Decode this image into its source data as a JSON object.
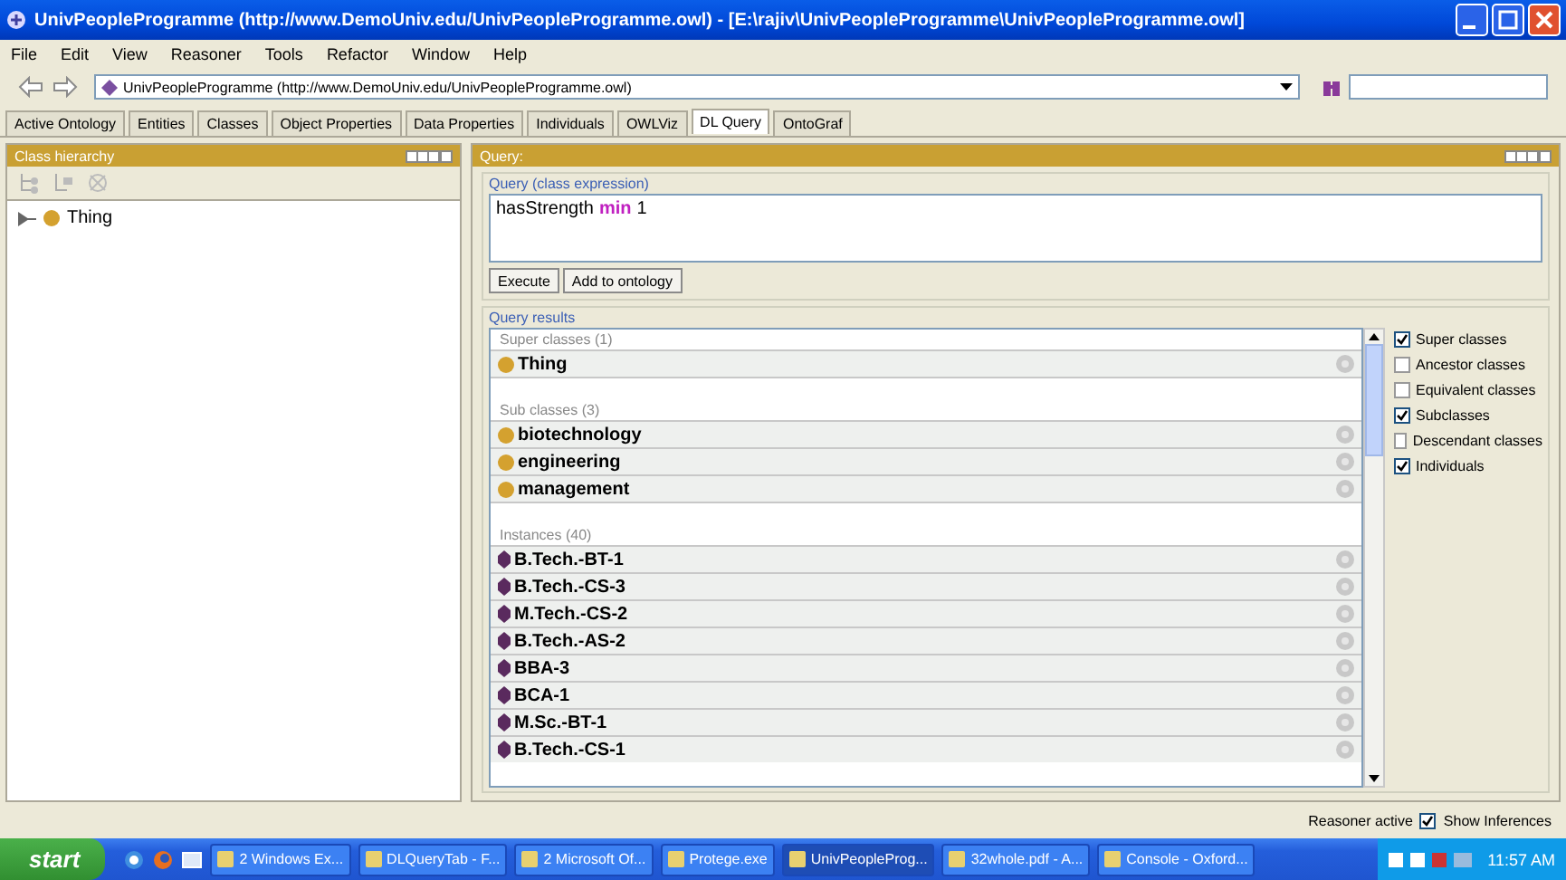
{
  "window": {
    "title": "UnivPeopleProgramme (http://www.DemoUniv.edu/UnivPeopleProgramme.owl) - [E:\\rajiv\\UnivPeopleProgramme\\UnivPeopleProgramme.owl]"
  },
  "menu": [
    "File",
    "Edit",
    "View",
    "Reasoner",
    "Tools",
    "Refactor",
    "Window",
    "Help"
  ],
  "address": {
    "value": "UnivPeopleProgramme (http://www.DemoUniv.edu/UnivPeopleProgramme.owl)"
  },
  "tabs": [
    {
      "label": "Active Ontology",
      "selected": false
    },
    {
      "label": "Entities",
      "selected": false
    },
    {
      "label": "Classes",
      "selected": false
    },
    {
      "label": "Object Properties",
      "selected": false
    },
    {
      "label": "Data Properties",
      "selected": false
    },
    {
      "label": "Individuals",
      "selected": false
    },
    {
      "label": "OWLViz",
      "selected": false
    },
    {
      "label": "DL Query",
      "selected": true
    },
    {
      "label": "OntoGraf",
      "selected": false
    }
  ],
  "class_hierarchy": {
    "title": "Class hierarchy",
    "tree": [
      {
        "label": "Thing",
        "expanded": false
      }
    ]
  },
  "query": {
    "title": "Query:",
    "expression_label": "Query (class expression)",
    "expression": [
      {
        "text": "hasStrength",
        "kind": "entity"
      },
      {
        "text": "min",
        "kind": "keyword"
      },
      {
        "text": "1",
        "kind": "literal"
      }
    ],
    "buttons": [
      "Execute",
      "Add to ontology"
    ]
  },
  "results": {
    "title": "Query results",
    "sections": [
      {
        "header": "Super classes (1)",
        "items": [
          {
            "label": "Thing",
            "kind": "class"
          }
        ]
      },
      {
        "header": "Sub classes (3)",
        "items": [
          {
            "label": "biotechnology",
            "kind": "class"
          },
          {
            "label": "engineering",
            "kind": "class"
          },
          {
            "label": "management",
            "kind": "class"
          }
        ]
      },
      {
        "header": "Instances (40)",
        "items": [
          {
            "label": "B.Tech.-BT-1",
            "kind": "individual"
          },
          {
            "label": "B.Tech.-CS-3",
            "kind": "individual"
          },
          {
            "label": "M.Tech.-CS-2",
            "kind": "individual"
          },
          {
            "label": "B.Tech.-AS-2",
            "kind": "individual"
          },
          {
            "label": "BBA-3",
            "kind": "individual"
          },
          {
            "label": "BCA-1",
            "kind": "individual"
          },
          {
            "label": "M.Sc.-BT-1",
            "kind": "individual"
          },
          {
            "label": "B.Tech.-CS-1",
            "kind": "individual"
          }
        ]
      }
    ]
  },
  "options": [
    {
      "label": "Super classes",
      "checked": true
    },
    {
      "label": "Ancestor classes",
      "checked": false
    },
    {
      "label": "Equivalent classes",
      "checked": false
    },
    {
      "label": "Subclasses",
      "checked": true
    },
    {
      "label": "Descendant classes",
      "checked": false
    },
    {
      "label": "Individuals",
      "checked": true
    }
  ],
  "status": {
    "reasoner": "Reasoner active",
    "show_inferences": {
      "label": "Show Inferences",
      "checked": true
    }
  },
  "taskbar": {
    "start": "start",
    "items": [
      {
        "label": "2 Windows Ex...",
        "selected": false
      },
      {
        "label": "DLQueryTab - F...",
        "selected": false
      },
      {
        "label": "2 Microsoft Of...",
        "selected": false
      },
      {
        "label": "Protege.exe",
        "selected": false
      },
      {
        "label": "UnivPeopleProg...",
        "selected": true
      },
      {
        "label": "32whole.pdf - A...",
        "selected": false
      },
      {
        "label": "Console - Oxford...",
        "selected": false
      }
    ],
    "clock": "11:57 AM"
  }
}
